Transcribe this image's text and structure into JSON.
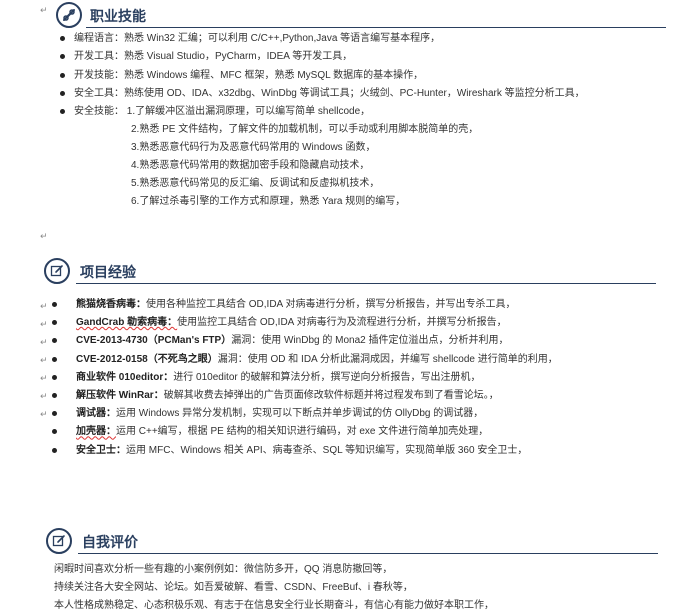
{
  "sections": {
    "skills": {
      "title": "职业技能",
      "items": [
        "编程语言：熟悉 Win32 汇编；可以利用 C/C++,Python,Java 等语言编写基本程序，",
        "开发工具：熟悉 Visual Studio，PyCharm，IDEA 等开发工具，",
        "开发技能：熟悉 Windows 编程、MFC 框架，熟悉 MySQL 数据库的基本操作，",
        "安全工具：熟练使用 OD、IDA、x32dbg、WinDbg 等调试工具；火绒剑、PC-Hunter，Wireshark 等监控分析工具，",
        "安全技能：  1.了解缓冲区溢出漏洞原理，可以编写简单 shellcode，"
      ],
      "security_details": [
        "2.熟悉 PE 文件结构，了解文件的加载机制，可以手动或利用脚本脱简单的壳，",
        "3.熟悉恶意代码行为及恶意代码常用的 Windows 函数，",
        "4.熟悉恶意代码常用的数据加密手段和隐藏启动技术，",
        "5.熟悉恶意代码常见的反汇编、反调试和反虚拟机技术，",
        "6.了解过杀毒引擎的工作方式和原理，熟悉 Yara 规则的编写，"
      ]
    },
    "projects": {
      "title": "项目经验",
      "items": [
        {
          "name": "熊猫烧香病毒：",
          "desc": "使用各种监控工具结合 OD,IDA 对病毒进行分析，撰写分析报告，并写出专杀工具，"
        },
        {
          "name": "GandCrab 勒索病毒：",
          "desc": "使用监控工具结合 OD,IDA 对病毒行为及流程进行分析，并撰写分析报告，"
        },
        {
          "name": "CVE-2013-4730（PCMan's FTP）",
          "desc": "漏洞：使用 WinDbg 的 Mona2 插件定位溢出点，分析并利用，"
        },
        {
          "name": "CVE-2012-0158（不死鸟之眼）",
          "desc": "漏洞：使用 OD 和 IDA 分析此漏洞成因，并编写 shellcode 进行简单的利用，"
        },
        {
          "name": "商业软件 010editor：",
          "desc": "进行 010editor 的破解和算法分析，撰写逆向分析报告，写出注册机，"
        },
        {
          "name": "解压软件 WinRar：",
          "desc": "破解其收费去掉弹出的广告页面修改软件标题并将过程发布到了看雪论坛。，"
        },
        {
          "name": "调试器：",
          "desc": "运用 Windows 异常分发机制，实现可以下断点并单步调试的仿 OllyDbg 的调试器，"
        },
        {
          "name": "加壳器：",
          "desc": "运用 C++编写，根据 PE 结构的相关知识进行编码，对 exe 文件进行简单加壳处理，"
        },
        {
          "name": "安全卫士：",
          "desc": "运用 MFC、Windows 相关 API、病毒查杀、SQL 等知识编写，实现简单版 360 安全卫士，"
        }
      ]
    },
    "self_eval": {
      "title": "自我评价",
      "lines": [
        "闲暇时间喜欢分析一些有趣的小案例例如：微信防多开，QQ 消息防撤回等，",
        "持续关注各大安全网站、论坛。如吾爱破解、看雪、CSDN、FreeBuf、i 春秋等，",
        "本人性格成熟稳定、心态积极乐观、有志于在信息安全行业长期奋斗，有信心有能力做好本职工作，"
      ]
    }
  },
  "marks": {
    "return": "↵"
  },
  "colors": {
    "accent": "#2a3f5f",
    "bullet": "#222222",
    "spell_error": "#dd3333"
  }
}
